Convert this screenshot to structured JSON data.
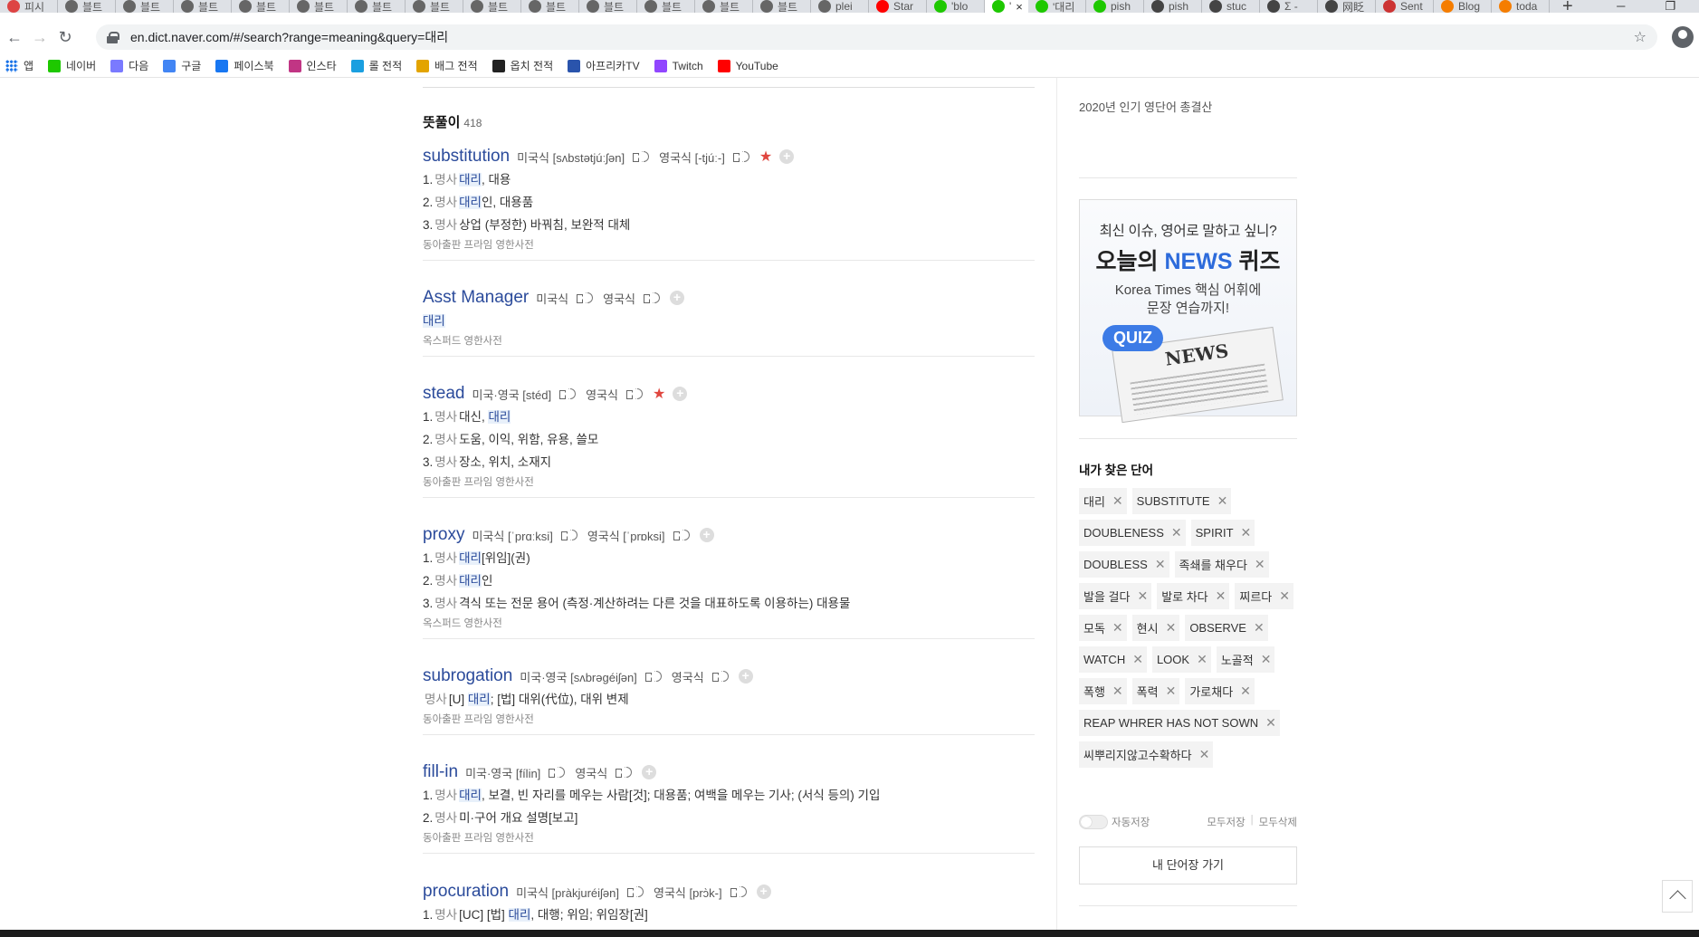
{
  "browser": {
    "tabs": [
      {
        "label": "피시",
        "color": "#d44"
      },
      {
        "label": "블트",
        "color": "#666"
      },
      {
        "label": "블트",
        "color": "#666"
      },
      {
        "label": "블트",
        "color": "#666"
      },
      {
        "label": "블트",
        "color": "#666"
      },
      {
        "label": "블트",
        "color": "#666"
      },
      {
        "label": "블트",
        "color": "#666"
      },
      {
        "label": "블트",
        "color": "#666"
      },
      {
        "label": "블트",
        "color": "#666"
      },
      {
        "label": "블트",
        "color": "#666"
      },
      {
        "label": "블트",
        "color": "#666"
      },
      {
        "label": "블트",
        "color": "#666"
      },
      {
        "label": "블트",
        "color": "#666"
      },
      {
        "label": "블트",
        "color": "#666"
      },
      {
        "label": "plei",
        "color": "#666"
      },
      {
        "label": "Star",
        "color": "#f00"
      },
      {
        "label": "'blo",
        "color": "#1ec800"
      },
      {
        "label": "'",
        "color": "#1ec800",
        "active": true
      },
      {
        "label": "'대리",
        "color": "#1ec800"
      },
      {
        "label": "pish",
        "color": "#1ec800"
      },
      {
        "label": "pish",
        "color": "#444"
      },
      {
        "label": "stuc",
        "color": "#444"
      },
      {
        "label": "Σ -",
        "color": "#444"
      },
      {
        "label": "网眨",
        "color": "#444"
      },
      {
        "label": "Sent",
        "color": "#c33"
      },
      {
        "label": "Blog",
        "color": "#f57d00"
      },
      {
        "label": "toda",
        "color": "#f57d00"
      }
    ],
    "new_tab": "+",
    "url": "en.dict.naver.com/#/search?range=meaning&query=대리"
  },
  "bookmarks": [
    {
      "label": "앱",
      "color": "#1a73e8",
      "grid": true
    },
    {
      "label": "네이버",
      "color": "#1ec800"
    },
    {
      "label": "다음",
      "color": "#7a7aff"
    },
    {
      "label": "구글",
      "color": "#4285f4"
    },
    {
      "label": "페이스북",
      "color": "#1877f2"
    },
    {
      "label": "인스타",
      "color": "#c13584"
    },
    {
      "label": "롤 전적",
      "color": "#1a9fe0"
    },
    {
      "label": "배그 전적",
      "color": "#e3a400"
    },
    {
      "label": "옵치 전적",
      "color": "#222"
    },
    {
      "label": "아프리카TV",
      "color": "#2a54ac"
    },
    {
      "label": "Twitch",
      "color": "#9146ff"
    },
    {
      "label": "YouTube",
      "color": "#f00"
    }
  ],
  "results": {
    "heading": "뜻풀이",
    "count": "418",
    "entries": [
      {
        "word": "substitution",
        "pron": [
          {
            "label": "미국식 [sʌbstətjúːʃən]"
          },
          {
            "label": "영국식 [-tjúː-]"
          }
        ],
        "starred": true,
        "meanings": [
          {
            "num": "1.",
            "pos": "명사",
            "hl": "대리",
            "rest": ", 대용"
          },
          {
            "num": "2.",
            "pos": "명사",
            "hl": "대리",
            "rest": "인, 대용품"
          },
          {
            "num": "3.",
            "pos": "명사",
            "hl": "",
            "rest": "상업 (부정한) 바꿔침, 보완적 대체"
          }
        ],
        "source": "동아출판 프라임 영한사전"
      },
      {
        "word": "Asst Manager",
        "pron": [
          {
            "label": "미국식"
          },
          {
            "label": "영국식"
          }
        ],
        "starred": false,
        "meanings": [
          {
            "num": "",
            "pos": "",
            "hl": "대리",
            "rest": ""
          }
        ],
        "source": "옥스퍼드 영한사전"
      },
      {
        "word": "stead",
        "pron": [
          {
            "label": "미국·영국 [stéd]"
          },
          {
            "label": "영국식"
          }
        ],
        "starred": true,
        "meanings": [
          {
            "num": "1.",
            "pos": "명사",
            "hl": "",
            "rest": "대신, ",
            "hl2": "대리"
          },
          {
            "num": "2.",
            "pos": "명사",
            "hl": "",
            "rest": "도움, 이익, 위함, 유용, 쓸모"
          },
          {
            "num": "3.",
            "pos": "명사",
            "hl": "",
            "rest": "장소, 위치, 소재지"
          }
        ],
        "source": "동아출판 프라임 영한사전"
      },
      {
        "word": "proxy",
        "pron": [
          {
            "label": "미국식 [ˈprɑːksi]"
          },
          {
            "label": "영국식 [ˈprɒksi]"
          }
        ],
        "starred": false,
        "meanings": [
          {
            "num": "1.",
            "pos": "명사",
            "hl": "대리",
            "rest": "[위임](권)"
          },
          {
            "num": "2.",
            "pos": "명사",
            "hl": "대리",
            "rest": "인"
          },
          {
            "num": "3.",
            "pos": "명사",
            "hl": "",
            "rest": "격식 또는 전문 용어 (측정·계산하려는 다른 것을 대표하도록 이용하는) 대용물"
          }
        ],
        "source": "옥스퍼드 영한사전"
      },
      {
        "word": "subrogation",
        "pron": [
          {
            "label": "미국·영국 [sʌbrəgéiʃən]"
          },
          {
            "label": "영국식"
          }
        ],
        "starred": false,
        "meanings": [
          {
            "num": "",
            "pos": "명사",
            "hl": "",
            "rest": "[U] ",
            "hl2": "대리",
            "rest2": "; [법] 대위(代位), 대위 변제"
          }
        ],
        "source": "동아출판 프라임 영한사전"
      },
      {
        "word": "fill-in",
        "pron": [
          {
            "label": "미국·영국 [fílin]"
          },
          {
            "label": "영국식"
          }
        ],
        "starred": false,
        "meanings": [
          {
            "num": "1.",
            "pos": "명사",
            "hl": "대리",
            "rest": ", 보결, 빈 자리를 메우는 사람[것]; 대용품; 여백을 메우는 기사; (서식 등의) 기입"
          },
          {
            "num": "2.",
            "pos": "명사",
            "hl": "",
            "rest": "미·구어 개요 설명[보고]"
          }
        ],
        "source": "동아출판 프라임 영한사전"
      },
      {
        "word": "procuration",
        "pron": [
          {
            "label": "미국식 [pràkjuréiʃən]"
          },
          {
            "label": "영국식 [prɔ̀k-]"
          }
        ],
        "starred": false,
        "meanings": [
          {
            "num": "1.",
            "pos": "명사",
            "hl": "",
            "rest": "[UC] [법] ",
            "hl2": "대리",
            "rest2": ", 대행; 위임; 위임장[권]"
          }
        ],
        "source": ""
      }
    ]
  },
  "sidebar": {
    "top_label": "2020년 인기 영단어 총결산",
    "ad": {
      "line1": "최신 이슈, 영어로 말하고 싶니?",
      "line2a": "오늘의 ",
      "line2b": "NEWS",
      "line2c": " 퀴즈",
      "line3": "Korea Times 핵심 어휘에",
      "line4": "문장 연습까지!",
      "badge": "QUIZ",
      "paper": "NEWS"
    },
    "my_words_title": "내가 찾은 단어",
    "my_words": [
      "대리",
      "SUBSTITUTE",
      "DOUBLENESS",
      "SPIRIT",
      "DOUBLESS",
      "족쇄를 채우다",
      "발을 걸다",
      "발로 차다",
      "찌르다",
      "모독",
      "현시",
      "OBSERVE",
      "WATCH",
      "LOOK",
      "노골적",
      "폭행",
      "폭력",
      "가로채다",
      "REAP WHRER HAS NOT SOWN",
      "씨뿌리지않고수확하다"
    ],
    "autosave": "자동저장",
    "save_all": "모두저장",
    "delete_all": "모두삭제",
    "go_button": "내 단어장 가기"
  }
}
